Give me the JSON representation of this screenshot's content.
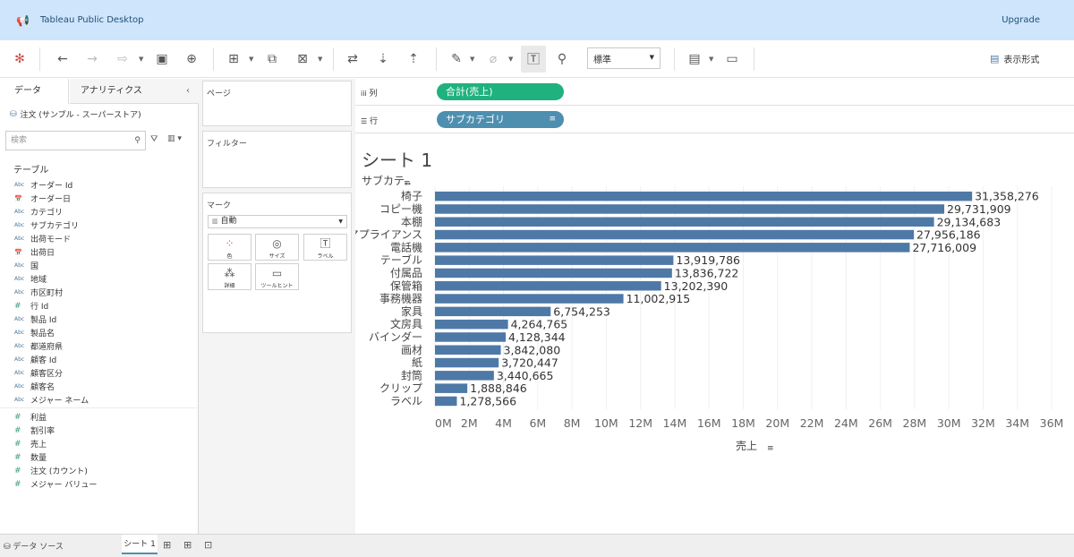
{
  "app": {
    "title": "Tableau Public Desktop",
    "upgrade_label": "Upgrade"
  },
  "toolbar": {
    "fit_value": "標準",
    "show_me_label": "表示形式"
  },
  "data_pane": {
    "tab_data": "データ",
    "tab_analytics": "アナリティクス",
    "datasource": "注文 (サンプル - スーパーストア)",
    "search_placeholder": "検索",
    "table_header": "テーブル",
    "dimensions": [
      {
        "type": "Abc",
        "name": "オーダー Id"
      },
      {
        "type": "date",
        "name": "オーダー日"
      },
      {
        "type": "Abc",
        "name": "カテゴリ"
      },
      {
        "type": "Abc",
        "name": "サブカテゴリ"
      },
      {
        "type": "Abc",
        "name": "出荷モード"
      },
      {
        "type": "date",
        "name": "出荷日"
      },
      {
        "type": "Abc",
        "name": "国"
      },
      {
        "type": "Abc",
        "name": "地域"
      },
      {
        "type": "Abc",
        "name": "市区町村"
      },
      {
        "type": "#",
        "name": "行 Id"
      },
      {
        "type": "Abc",
        "name": "製品 Id"
      },
      {
        "type": "Abc",
        "name": "製品名"
      },
      {
        "type": "Abc",
        "name": "都道府県"
      },
      {
        "type": "Abc",
        "name": "顧客 Id"
      },
      {
        "type": "Abc",
        "name": "顧客区分"
      },
      {
        "type": "Abc",
        "name": "顧客名"
      },
      {
        "type": "Abc",
        "name": "メジャー ネーム"
      }
    ],
    "measures": [
      {
        "type": "#",
        "name": "利益"
      },
      {
        "type": "#",
        "name": "割引率"
      },
      {
        "type": "#",
        "name": "売上"
      },
      {
        "type": "#",
        "name": "数量"
      },
      {
        "type": "#",
        "name": "注文 (カウント)"
      },
      {
        "type": "#",
        "name": "メジャー バリュー"
      }
    ]
  },
  "cards": {
    "pages": "ページ",
    "filters": "フィルター",
    "marks": "マーク",
    "mark_type": "自動",
    "mark_buttons": [
      "色",
      "サイズ",
      "ラベル",
      "詳細",
      "ツールヒント"
    ]
  },
  "shelves": {
    "columns_label": "列",
    "columns_pill": "合計(売上)",
    "rows_label": "行",
    "rows_pill": "サブカテゴリ"
  },
  "sheet": {
    "title": "シート 1"
  },
  "bottom": {
    "datasource_tab": "データ ソース",
    "sheet_tab": "シート 1"
  },
  "chart_data": {
    "type": "bar",
    "orientation": "horizontal",
    "header_label": "サブカテ..",
    "xlabel": "売上",
    "categories": [
      "椅子",
      "コピー機",
      "本棚",
      "アプライアンス",
      "電話機",
      "テーブル",
      "付属品",
      "保管箱",
      "事務機器",
      "家具",
      "文房具",
      "バインダー",
      "画材",
      "紙",
      "封筒",
      "クリップ",
      "ラベル"
    ],
    "values": [
      31358276,
      29731909,
      29134683,
      27956186,
      27716009,
      13919786,
      13836722,
      13202390,
      11002915,
      6754253,
      4264765,
      4128344,
      3842080,
      3720447,
      3440665,
      1888846,
      1278566
    ],
    "value_labels": [
      "31,358,276",
      "29,731,909",
      "29,134,683",
      "27,956,186",
      "27,716,009",
      "13,919,786",
      "13,836,722",
      "13,202,390",
      "11,002,915",
      "6,754,253",
      "4,264,765",
      "4,128,344",
      "3,842,080",
      "3,720,447",
      "3,440,665",
      "1,888,846",
      "1,278,566"
    ],
    "xlim": [
      0,
      36000000
    ],
    "xticks": [
      0,
      2000000,
      4000000,
      6000000,
      8000000,
      10000000,
      12000000,
      14000000,
      16000000,
      18000000,
      20000000,
      22000000,
      24000000,
      26000000,
      28000000,
      30000000,
      32000000,
      34000000,
      36000000
    ],
    "xtick_labels": [
      "0M",
      "2M",
      "4M",
      "6M",
      "8M",
      "10M",
      "12M",
      "14M",
      "16M",
      "18M",
      "20M",
      "22M",
      "24M",
      "26M",
      "28M",
      "30M",
      "32M",
      "34M",
      "36M"
    ],
    "bar_color": "#4e79a7",
    "grid": true
  }
}
